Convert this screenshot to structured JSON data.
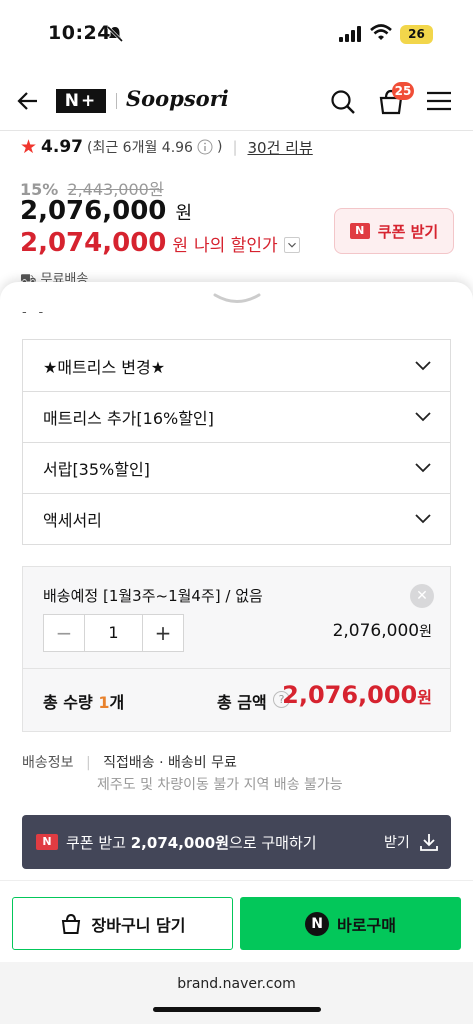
{
  "status_bar": {
    "time": "10:24",
    "battery": "26"
  },
  "header": {
    "brand_badge": "N+",
    "brand_name": "Soopsori",
    "cart_count": "25"
  },
  "product": {
    "rating_star": "★",
    "rating": "4.97",
    "recent_rating": "(최근 6개월 4.96",
    "reviews": "30건 리뷰",
    "discount_pct": "15%",
    "original_price": "2,443,000원",
    "price": "2,076,000",
    "price_unit": "원",
    "my_price": "2,074,000",
    "my_price_unit": "원",
    "my_price_label": "나의 할인가",
    "coupon_button": "쿠폰 받기",
    "free_shipping": "무료배송"
  },
  "options": [
    {
      "label": "★매트리스 변경★"
    },
    {
      "label": "매트리스 추가[16%할인]"
    },
    {
      "label": "서랍[35%할인]"
    },
    {
      "label": "액세서리"
    }
  ],
  "selected": {
    "name": "배송예정 [1월3주~1월4주] / 없음",
    "quantity": "1",
    "line_price": "2,076,000",
    "line_price_unit": "원",
    "total_qty_label": "총 수량 ",
    "total_qty": "1",
    "total_qty_unit": "개",
    "total_label": "총 금액",
    "total_price": "2,076,000",
    "total_price_unit": "원"
  },
  "shipping": {
    "label": "배송정보",
    "info": "직접배송 · 배송비 무료",
    "note": "제주도 및 차량이동 불가 지역 배송 불가능"
  },
  "coupon_bar": {
    "badge": "N",
    "prefix": "쿠폰 받고 ",
    "amount": "2,074,000원",
    "suffix": "으로 구매하기",
    "get": "받기"
  },
  "actions": {
    "cart": "장바구니 담기",
    "buy": "바로구매",
    "buy_badge": "N"
  },
  "browser": {
    "url": "brand.naver.com"
  },
  "colors": {
    "accent_red": "#d6232f",
    "naver_green": "#03c75a",
    "coupon_bar_bg": "#434658"
  }
}
